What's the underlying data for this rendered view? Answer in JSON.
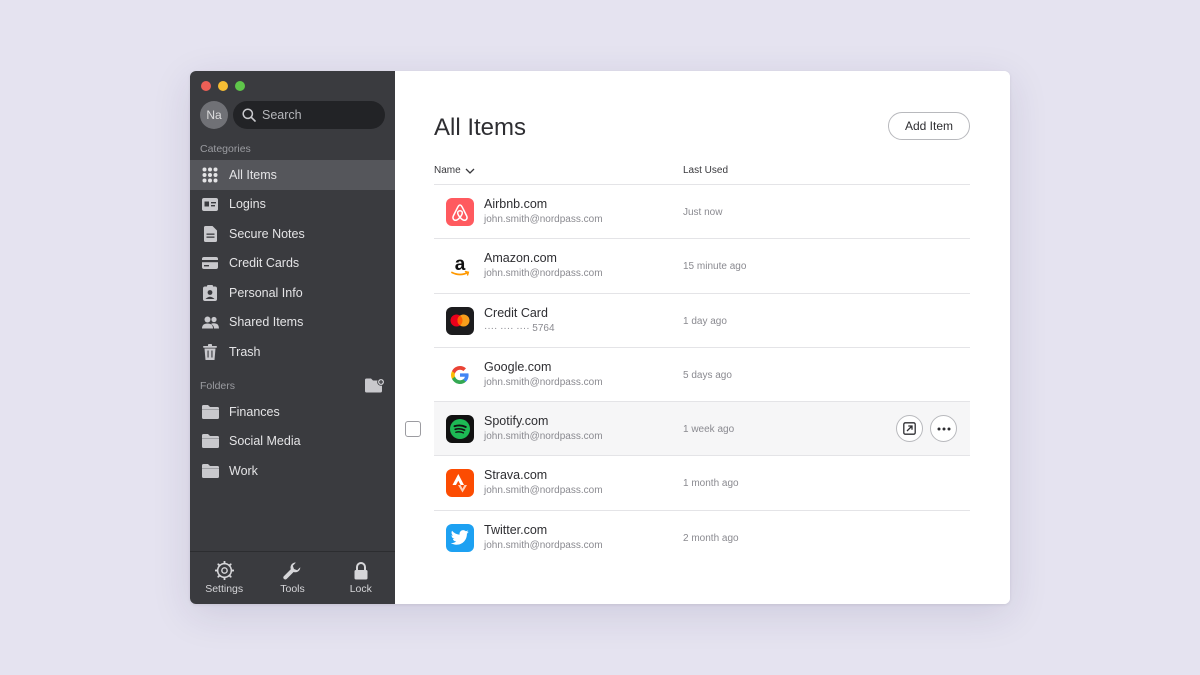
{
  "user": {
    "initials": "Na"
  },
  "search": {
    "placeholder": "Search"
  },
  "sidebar": {
    "categories_label": "Categories",
    "categories": [
      {
        "label": "All Items",
        "icon": "grid-icon",
        "active": true
      },
      {
        "label": "Logins",
        "icon": "id-card-icon"
      },
      {
        "label": "Secure Notes",
        "icon": "note-icon"
      },
      {
        "label": "Credit Cards",
        "icon": "credit-card-icon"
      },
      {
        "label": "Personal Info",
        "icon": "personal-info-icon"
      },
      {
        "label": "Shared Items",
        "icon": "people-icon"
      },
      {
        "label": "Trash",
        "icon": "trash-icon"
      }
    ],
    "folders_label": "Folders",
    "folders": [
      {
        "label": "Finances",
        "icon": "folder-icon"
      },
      {
        "label": "Social Media",
        "icon": "folder-icon"
      },
      {
        "label": "Work",
        "icon": "folder-icon"
      }
    ],
    "footer": [
      {
        "label": "Settings",
        "icon": "gear-icon"
      },
      {
        "label": "Tools",
        "icon": "wrench-icon"
      },
      {
        "label": "Lock",
        "icon": "lock-icon"
      }
    ]
  },
  "main": {
    "title": "All Items",
    "add_button": "Add Item",
    "columns": {
      "name": "Name",
      "last_used": "Last Used"
    },
    "items": [
      {
        "title": "Airbnb.com",
        "subtitle": "john.smith@nordpass.com",
        "last_used": "Just now",
        "icon": "airbnb-icon",
        "color": "#ff5a5f"
      },
      {
        "title": "Amazon.com",
        "subtitle": "john.smith@nordpass.com",
        "last_used": "15 minute ago",
        "icon": "amazon-icon",
        "color": "#ffffff"
      },
      {
        "title": "Credit Card",
        "subtitle": "···· ···· ···· 5764",
        "last_used": "1 day ago",
        "icon": "mastercard-icon",
        "color": "#1c1c1e"
      },
      {
        "title": "Google.com",
        "subtitle": "john.smith@nordpass.com",
        "last_used": "5 days ago",
        "icon": "google-icon",
        "color": "#ffffff"
      },
      {
        "title": "Spotify.com",
        "subtitle": "john.smith@nordpass.com",
        "last_used": "1 week ago",
        "icon": "spotify-icon",
        "color": "#1db954"
      },
      {
        "title": "Strava.com",
        "subtitle": "john.smith@nordpass.com",
        "last_used": "1 month ago",
        "icon": "strava-icon",
        "color": "#fc4c02"
      },
      {
        "title": "Twitter.com",
        "subtitle": "john.smith@nordpass.com",
        "last_used": "2 month ago",
        "icon": "twitter-icon",
        "color": "#1da1f2"
      }
    ]
  }
}
